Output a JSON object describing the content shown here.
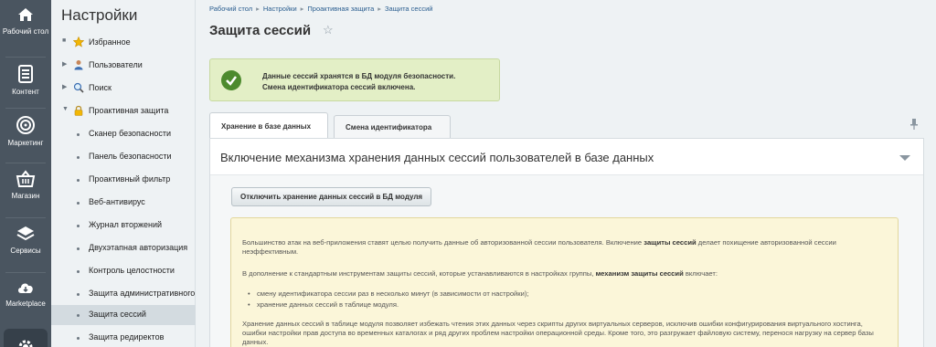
{
  "rail": {
    "items": [
      {
        "label": "Рабочий стол",
        "icon": "home-icon"
      },
      {
        "label": "Контент",
        "icon": "document-icon"
      },
      {
        "label": "Маркетинг",
        "icon": "target-icon"
      },
      {
        "label": "Магазин",
        "icon": "basket-icon"
      },
      {
        "label": "Сервисы",
        "icon": "layers-icon"
      },
      {
        "label": "Marketplace",
        "icon": "cloud-download-icon"
      }
    ],
    "partial_bottom_icon": "gear-icon"
  },
  "menu": {
    "title": "Настройки",
    "items": [
      {
        "label": "Избранное",
        "icon": "star-icon",
        "marker": "■"
      },
      {
        "label": "Пользователи",
        "icon": "user-icon",
        "marker": "▶"
      },
      {
        "label": "Поиск",
        "icon": "magnifier-icon",
        "marker": "▶"
      },
      {
        "label": "Проактивная защита",
        "icon": "lock-icon",
        "marker": "▼"
      },
      {
        "label": "Сканер безопасности"
      },
      {
        "label": "Панель безопасности"
      },
      {
        "label": "Проактивный фильтр"
      },
      {
        "label": "Веб-антивирус"
      },
      {
        "label": "Журнал вторжений"
      },
      {
        "label": "Двухэтапная авторизация"
      },
      {
        "label": "Контроль целостности"
      },
      {
        "label": "Защита административного"
      },
      {
        "label": "Защита сессий"
      },
      {
        "label": "Защита редиректов"
      }
    ]
  },
  "breadcrumb": [
    "Рабочий стол",
    "Настройки",
    "Проактивная защита",
    "Защита сессий"
  ],
  "page_title": "Защита сессий",
  "notice": {
    "line1": "Данные сессий хранятся в БД модуля безопасности.",
    "line2": "Смена идентификатора сессий включена."
  },
  "tabs": [
    "Хранение в базе данных",
    "Смена идентификатора"
  ],
  "panel": {
    "title": "Включение механизма хранения данных сессий пользователей в базе данных",
    "button": "Отключить хранение данных сессий в БД модуля"
  },
  "info": {
    "p1_a": "Большинство атак на веб-приложения ставят целью получить данные об авторизованной сессии пользователя. Включение ",
    "p1_b": "защиты сессий",
    "p1_c": " делает похищение авторизованной сессии неэффективным.",
    "p2_a": "В дополнение к стандартным инструментам защиты сессий, которые устанавливаются в настройках группы, ",
    "p2_b": "механизм защиты сессий",
    "p2_c": " включает:",
    "li1": "смену идентификатора сессии раз в несколько минут (в зависимости от настройки);",
    "li2": "хранение данных сессий в таблице модуля.",
    "p3": "Хранение данных сессий в таблице модуля позволяет избежать чтения этих данных через скрипты других виртуальных серверов, исключив ошибки конфигурирования виртуального хостинга, ошибки настройки прав доступа во временных каталогах и ряд других проблем настройки операционной среды. Кроме того, это разгружает файловую систему, перенося нагрузку на сервер базы данных."
  },
  "colors": {
    "rail_bg": "#4a5560",
    "notice_bg": "#e3efc6",
    "check_green": "#4d8a2e",
    "info_bg": "#fbf6d9",
    "link": "#2a5d8f"
  }
}
